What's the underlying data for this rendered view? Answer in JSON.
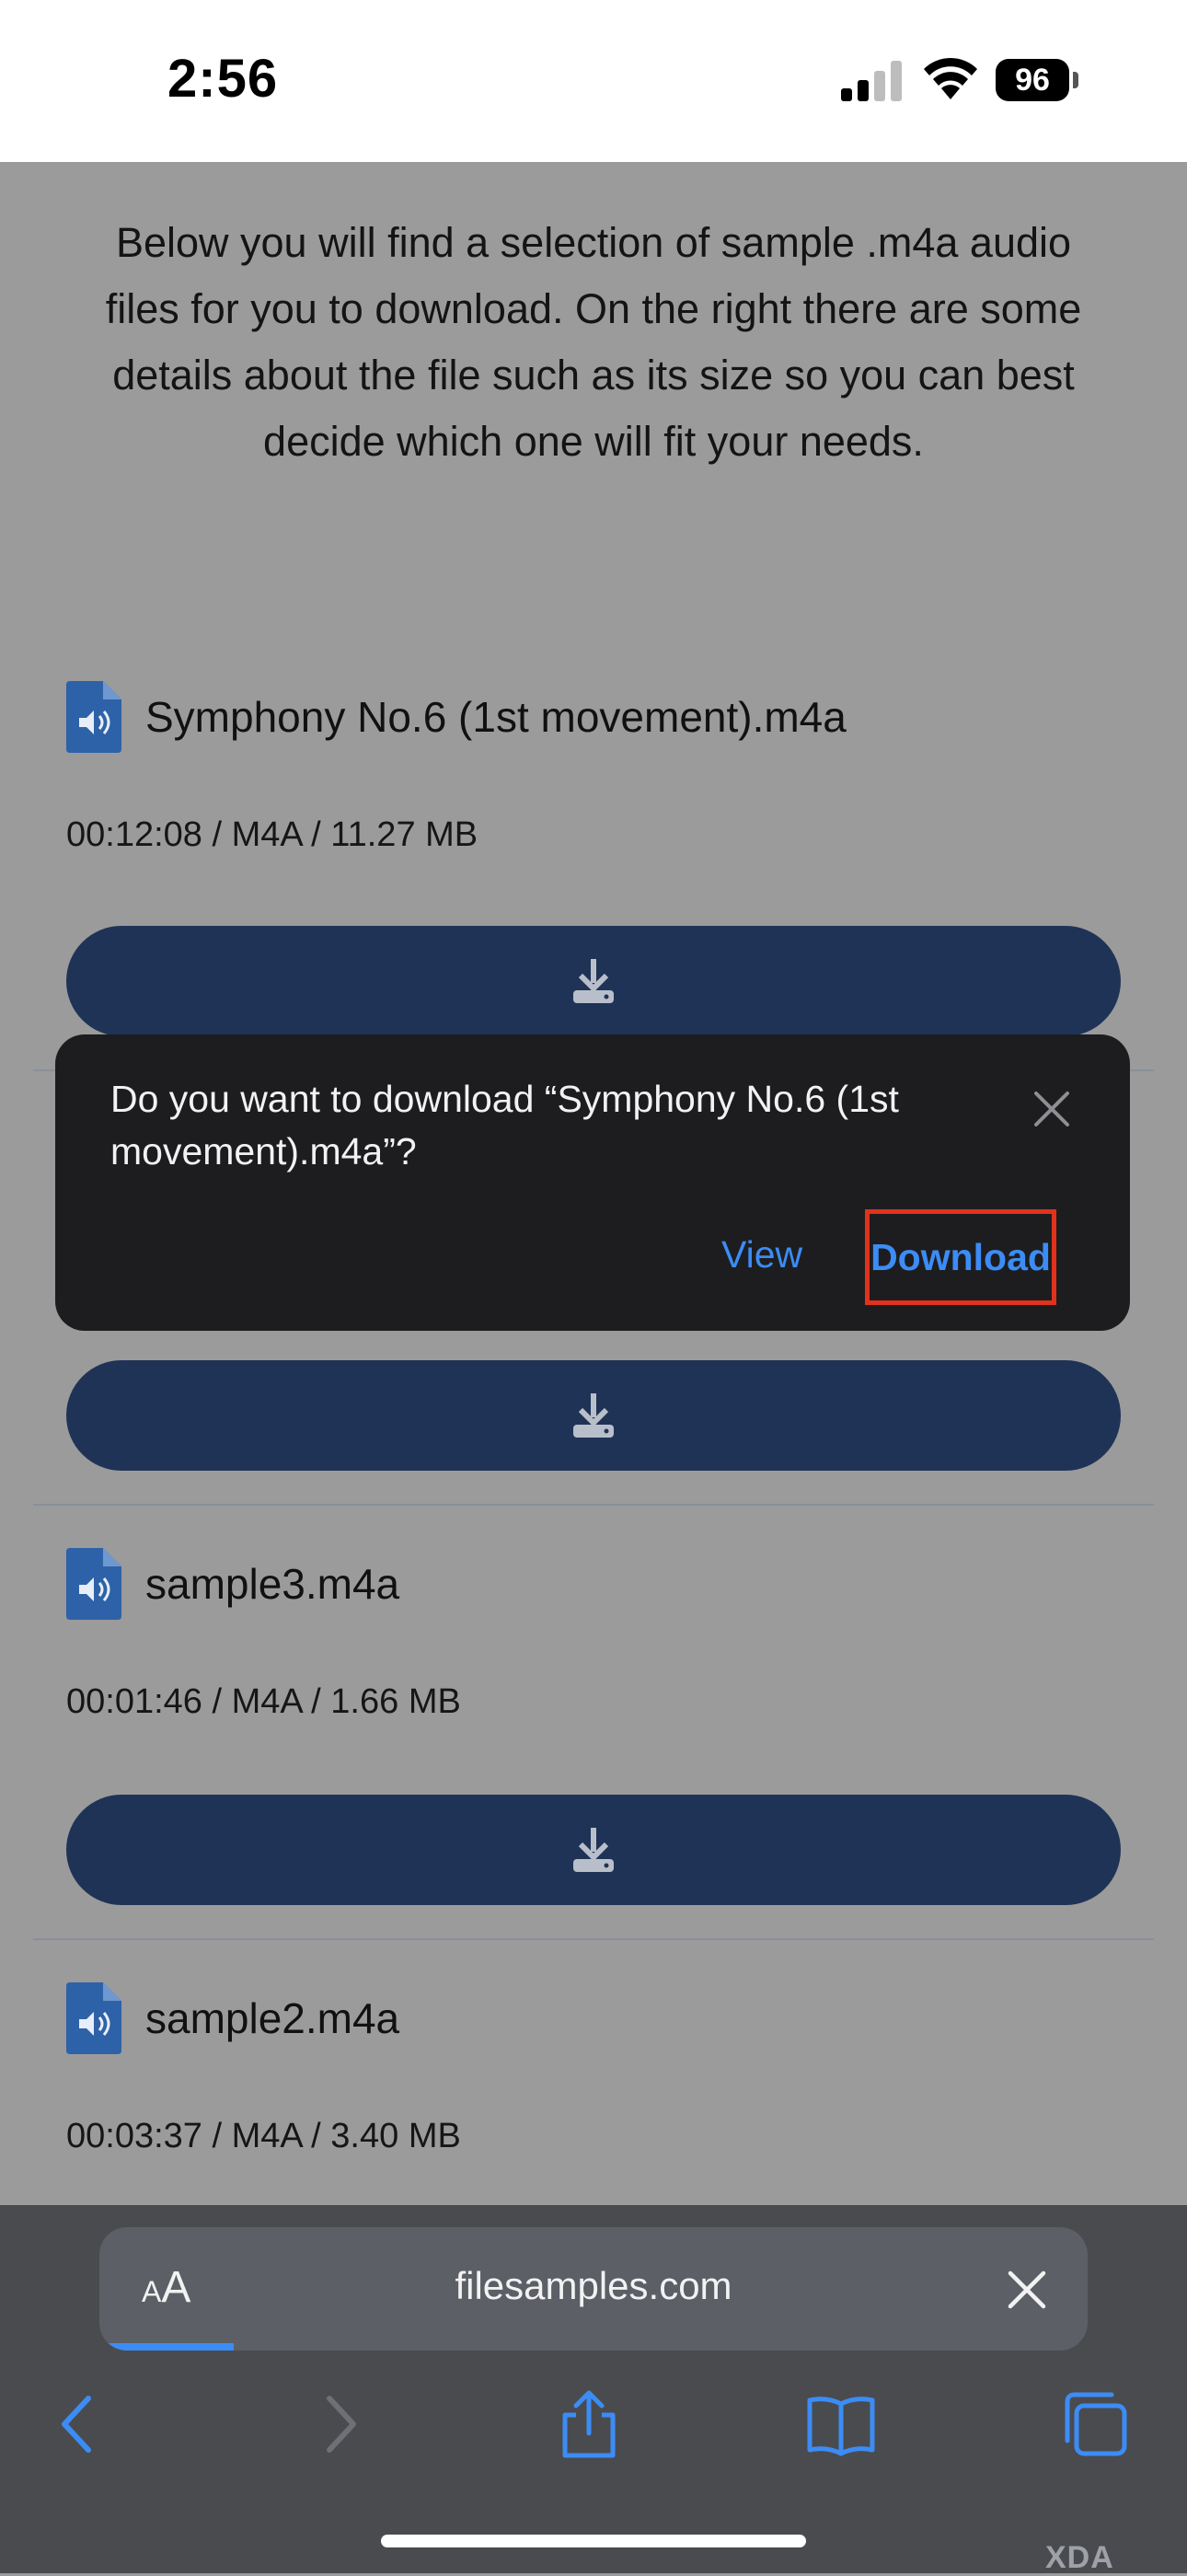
{
  "status_bar": {
    "time": "2:56",
    "battery": "96"
  },
  "page": {
    "intro": "Below you will find a selection of sample .m4a audio files for you to download. On the right there are some details about the file such as its size so you can best decide which one will fit your needs.",
    "files": [
      {
        "title": "Symphony No.6 (1st movement).m4a",
        "meta": "00:12:08 / M4A / 11.27 MB"
      },
      {
        "title": "sample3.m4a",
        "meta": "00:01:46 / M4A / 1.66 MB"
      },
      {
        "title": "sample2.m4a",
        "meta": "00:03:37 / M4A / 3.40 MB"
      }
    ]
  },
  "download_prompt": {
    "message": "Do you want to download “Symphony No.6 (1st movement).m4a”?",
    "view_label": "View",
    "download_label": "Download"
  },
  "browser": {
    "text_size_label_small": "A",
    "text_size_label_large": "A",
    "url": "filesamples.com",
    "toolbar_icons": [
      "back-icon",
      "forward-icon",
      "share-icon",
      "bookmarks-icon",
      "tabs-icon"
    ]
  },
  "watermark": "XDA",
  "colors": {
    "button": "#1f3356",
    "accent": "#3c8cf5",
    "highlight": "#e0321c",
    "prompt_bg": "#1d1d1f"
  }
}
